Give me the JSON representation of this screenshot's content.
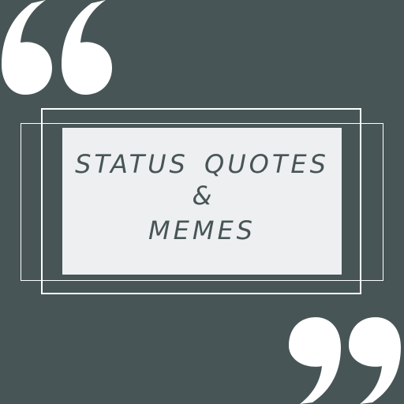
{
  "colors": {
    "background": "#475556",
    "accent": "#ffffff",
    "panel": "#eeeff1",
    "text": "#475556"
  },
  "logo": {
    "title_line_1": "STATUS QUOTES",
    "title_line_2": "&",
    "title_line_3": "MEMES"
  },
  "icons": {
    "open_quote": "open-quote-icon",
    "close_quote": "close-quote-icon"
  }
}
